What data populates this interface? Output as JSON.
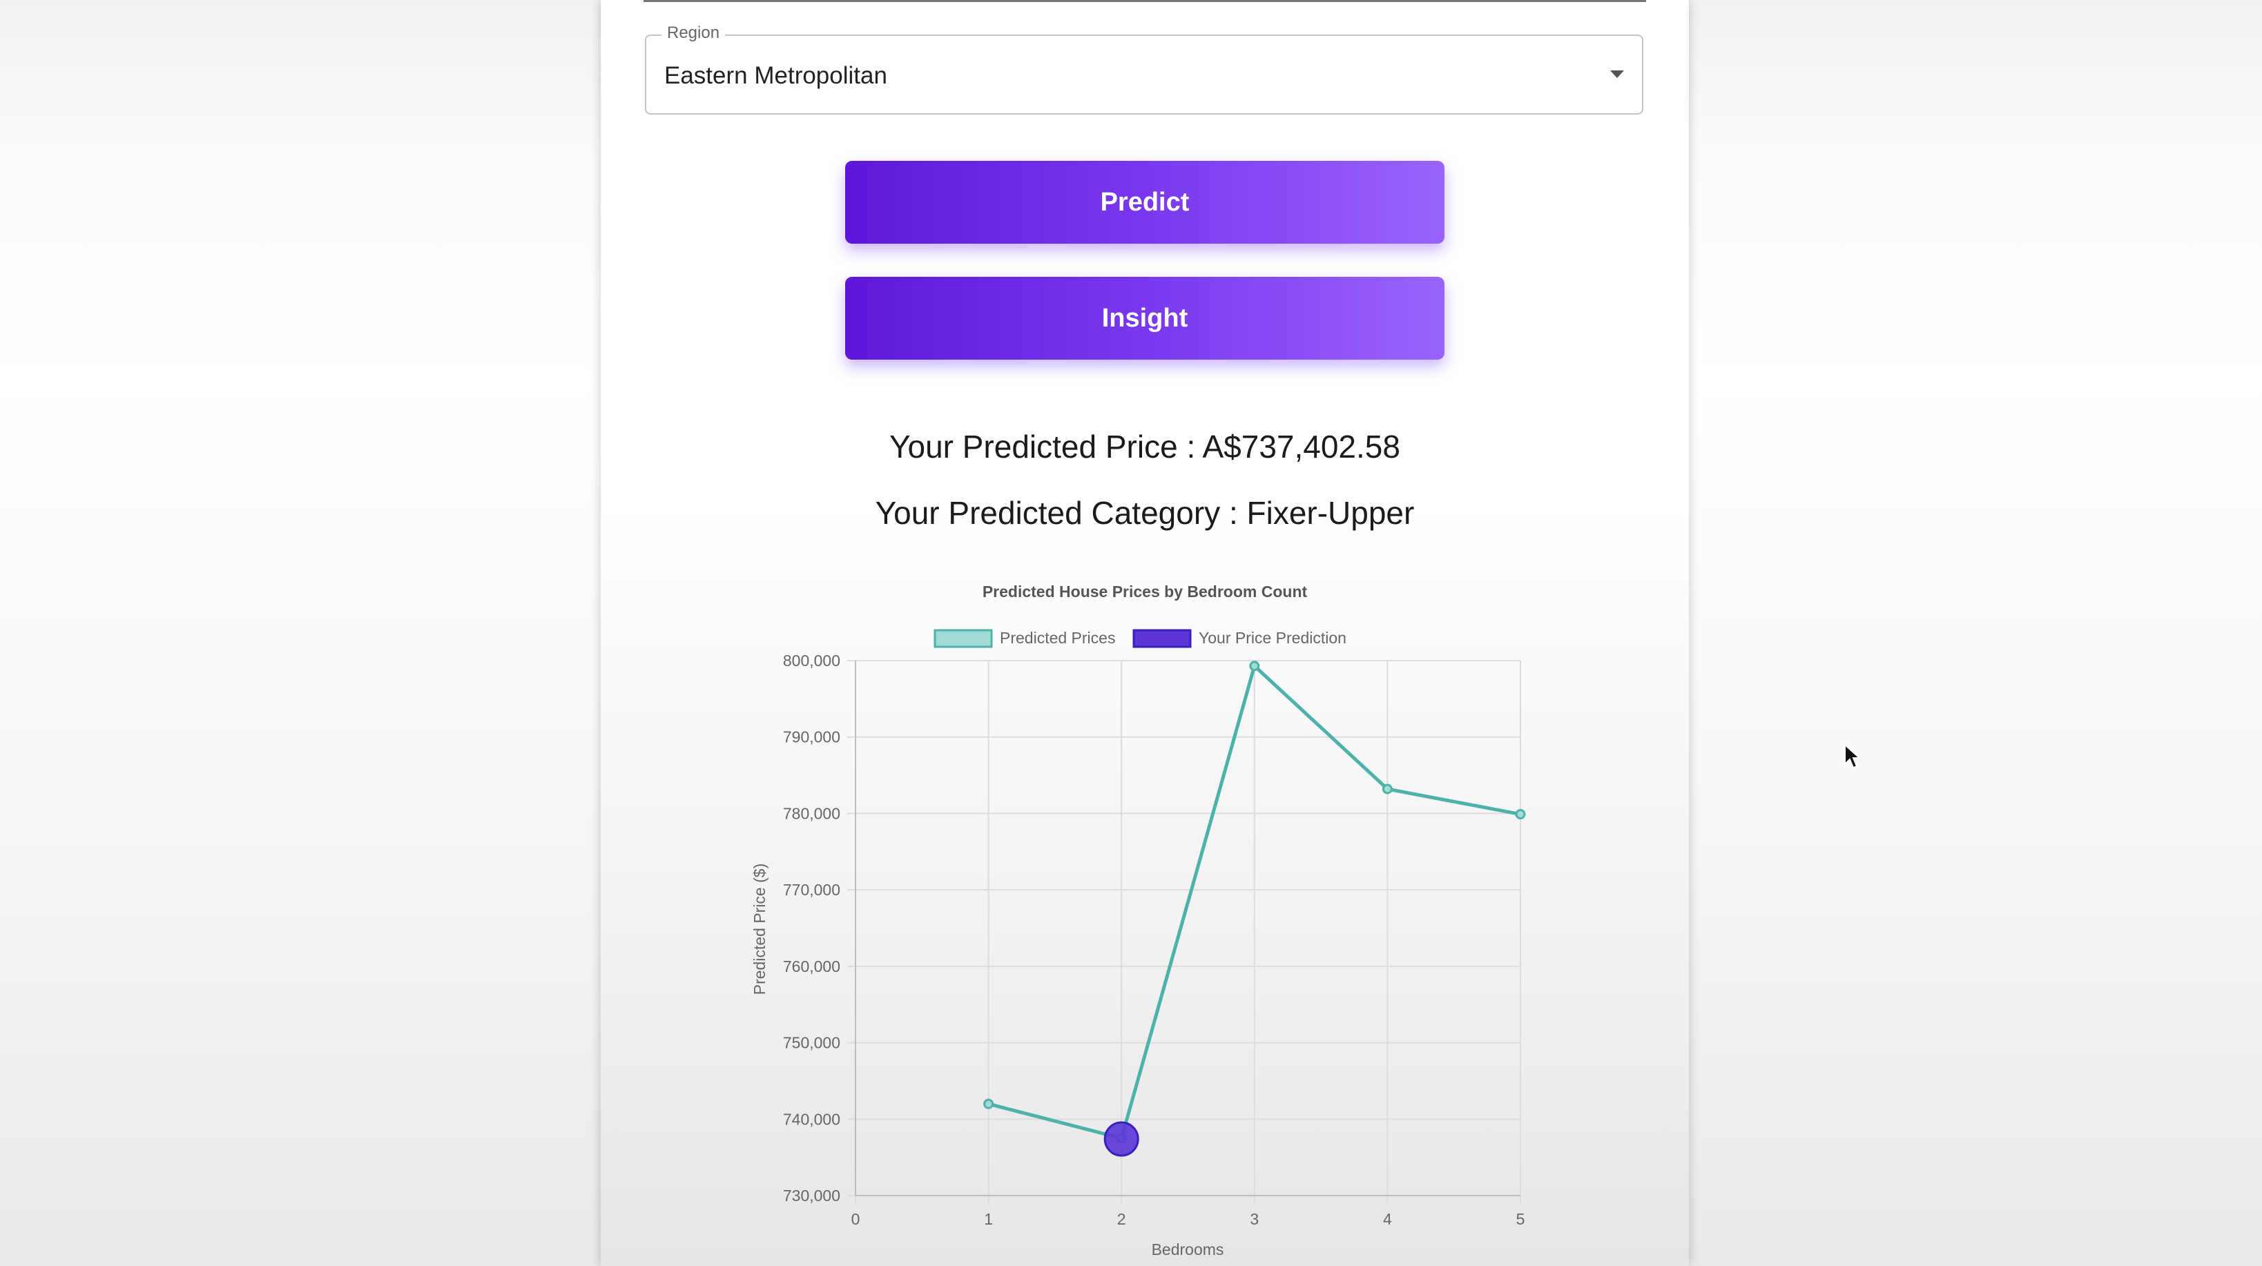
{
  "form": {
    "region_label": "Region",
    "region_value": "Eastern Metropolitan"
  },
  "buttons": {
    "predict_label": "Predict",
    "insight_label": "Insight"
  },
  "results": {
    "price_text": "Your Predicted Price : A$737,402.58",
    "category_text": "Your Predicted Category : Fixer-Upper"
  },
  "colors": {
    "button_start": "#5f16d8",
    "button_end": "#9a64fa",
    "series_line": "#4db3aa",
    "series_fill": "#a3dcd7",
    "prediction_fill": "#5b35d6",
    "prediction_border": "#3a1fbf"
  },
  "chart_data": {
    "type": "line",
    "title": "Predicted House Prices by Bedroom Count",
    "xlabel": "Bedrooms",
    "ylabel": "Predicted Price ($)",
    "xlim": [
      0,
      5
    ],
    "ylim": [
      730000,
      800000
    ],
    "x_ticks": [
      "0",
      "1",
      "2",
      "3",
      "4",
      "5"
    ],
    "y_ticks": [
      "730,000",
      "740,000",
      "750,000",
      "760,000",
      "770,000",
      "780,000",
      "790,000",
      "800,000"
    ],
    "grid": true,
    "legend_position": "top",
    "series": [
      {
        "name": "Predicted Prices",
        "x": [
          1,
          2,
          3,
          4,
          5
        ],
        "y": [
          742000,
          737500,
          799300,
          783200,
          779900
        ]
      },
      {
        "name": "Your Price Prediction",
        "x": [
          2
        ],
        "y": [
          737402.58
        ]
      }
    ]
  }
}
